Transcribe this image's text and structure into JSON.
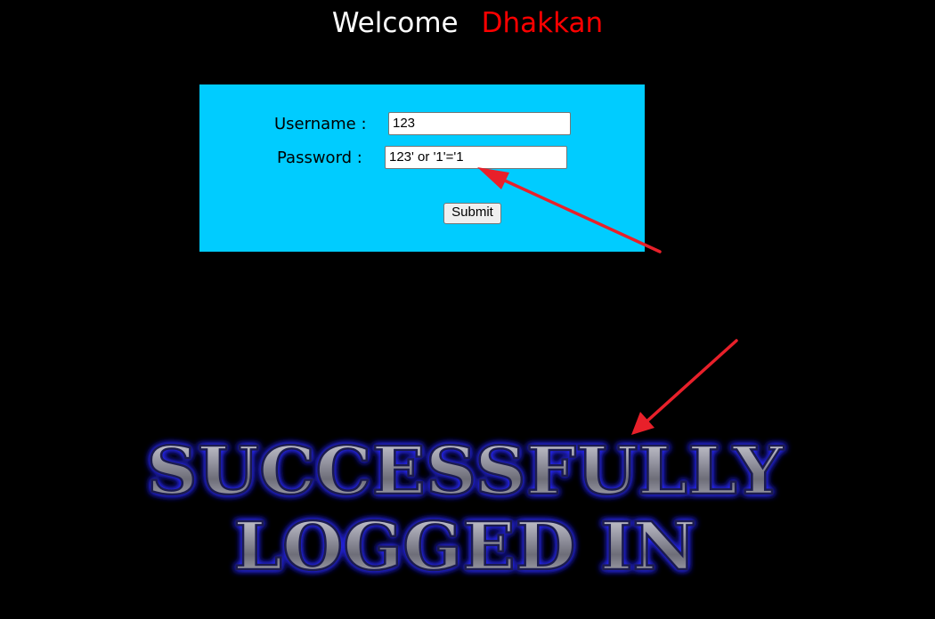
{
  "header": {
    "welcome_word": "Welcome",
    "user_name": "Dhakkan"
  },
  "login_form": {
    "username_label": "Username :",
    "username_value": "123",
    "password_label": "Password :",
    "password_value": "123' or '1'='1",
    "submit_label": "Submit"
  },
  "banner": {
    "line1": "SUCCESSFULLY",
    "line2": "LOGGED IN"
  },
  "colors": {
    "background": "#000000",
    "form_background": "#00ccff",
    "name_red": "#ff0000",
    "arrow_red": "#e8202a",
    "banner_glow": "#2a2aff"
  }
}
